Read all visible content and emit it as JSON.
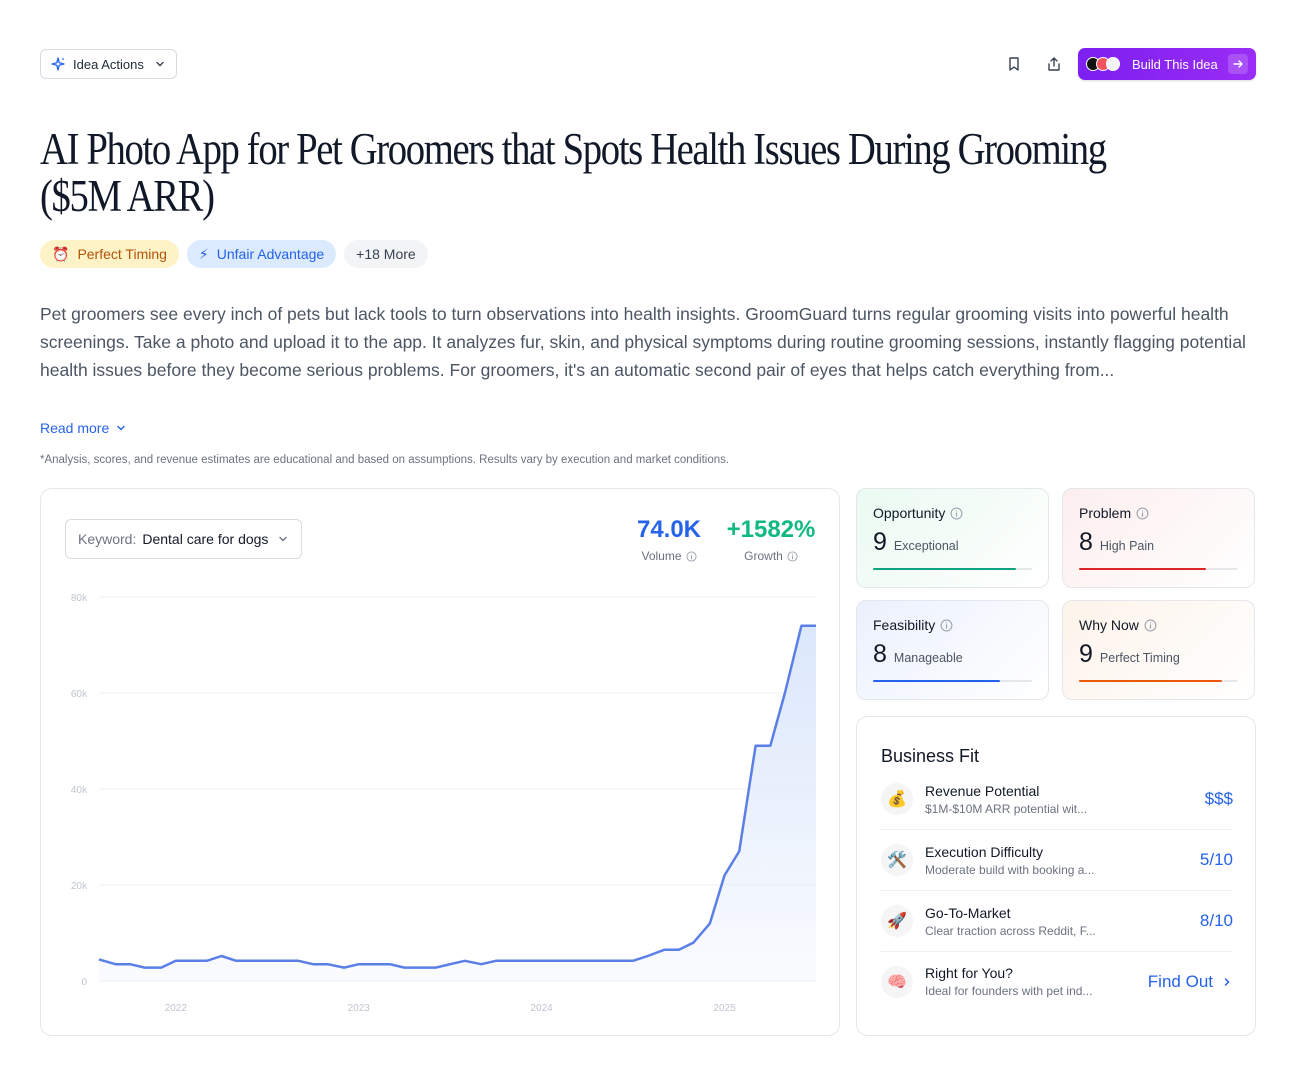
{
  "toolbar": {
    "idea_actions_label": "Idea Actions",
    "build_label": "Build This Idea"
  },
  "title": "AI Photo App for Pet Groomers that Spots Health Issues During Grooming ($5M ARR)",
  "tags": [
    {
      "icon": "alarm-clock-icon",
      "label": "Perfect Timing"
    },
    {
      "icon": "lightning-icon",
      "label": "Unfair Advantage"
    },
    {
      "label": "+18 More"
    }
  ],
  "description": "Pet groomers see every inch of pets but lack tools to turn observations into health insights. GroomGuard turns regular grooming visits into powerful health screenings. Take a photo and upload it to the app. It analyzes fur, skin, and physical symptoms during routine grooming sessions, instantly flagging potential health issues before they become serious problems. For groomers, it's an automatic second pair of eyes that helps catch everything from...",
  "read_more": "Read more",
  "disclaimer": "*Analysis, scores, and revenue estimates are educational and based on assumptions. Results vary by execution and market conditions.",
  "keyword": {
    "label": "Keyword:",
    "value": "Dental care for dogs"
  },
  "metrics": {
    "volume": {
      "value": "74.0K",
      "label": "Volume",
      "color": "#2563eb"
    },
    "growth": {
      "value": "+1582%",
      "label": "Growth",
      "color": "#10b981"
    }
  },
  "chart_data": {
    "type": "area",
    "ylim": [
      0,
      80000
    ],
    "yticks": [
      0,
      20000,
      40000,
      60000,
      80000
    ],
    "ytick_labels": [
      "0",
      "20k",
      "40k",
      "60k",
      "80k"
    ],
    "xtick_labels": [
      "2022",
      "2023",
      "2024",
      "2025"
    ],
    "xtick_positions": [
      2022.0,
      2023.0,
      2024.0,
      2025.0
    ],
    "x": [
      2021.58,
      2021.67,
      2021.75,
      2021.83,
      2021.92,
      2022.0,
      2022.08,
      2022.17,
      2022.25,
      2022.33,
      2022.42,
      2022.5,
      2022.58,
      2022.67,
      2022.75,
      2022.83,
      2022.92,
      2023.0,
      2023.08,
      2023.17,
      2023.25,
      2023.33,
      2023.42,
      2023.5,
      2023.58,
      2023.67,
      2023.75,
      2023.83,
      2023.92,
      2024.0,
      2024.08,
      2024.17,
      2024.25,
      2024.33,
      2024.42,
      2024.5,
      2024.58,
      2024.67,
      2024.75,
      2024.83,
      2024.92,
      2025.0,
      2025.08,
      2025.17,
      2025.25,
      2025.33,
      2025.42,
      2025.5
    ],
    "values": [
      4500,
      3500,
      3500,
      2800,
      2800,
      4200,
      4200,
      4200,
      5200,
      4200,
      4200,
      4200,
      4200,
      4200,
      3500,
      3500,
      2800,
      3500,
      3500,
      3500,
      2800,
      2800,
      2800,
      3500,
      4200,
      3500,
      4200,
      4200,
      4200,
      4200,
      4200,
      4200,
      4200,
      4200,
      4200,
      4200,
      5200,
      6500,
      6500,
      8000,
      12000,
      22000,
      27000,
      49000,
      49000,
      60000,
      74000,
      74000
    ],
    "line_color": "#5b7fe6",
    "fill_color": "#dbe7fb"
  },
  "scores": [
    {
      "title": "Opportunity",
      "score": "9",
      "quality": "Exceptional",
      "fraction": 0.9,
      "color": "#10a37f",
      "bg": "#eafaf1"
    },
    {
      "title": "Problem",
      "score": "8",
      "quality": "High Pain",
      "fraction": 0.8,
      "color": "#dc2626",
      "bg": "#fdeeee"
    },
    {
      "title": "Feasibility",
      "score": "8",
      "quality": "Manageable",
      "fraction": 0.8,
      "color": "#2563eb",
      "bg": "#ebf1fd"
    },
    {
      "title": "Why Now",
      "score": "9",
      "quality": "Perfect Timing",
      "fraction": 0.9,
      "color": "#ea580c",
      "bg": "#fdf3ea"
    }
  ],
  "business_fit": {
    "title": "Business Fit",
    "rows": [
      {
        "icon": "money-bag-icon",
        "emoji": "💰",
        "title": "Revenue Potential",
        "subtitle": "$1M-$10M ARR potential wit...",
        "value": "$$$"
      },
      {
        "icon": "tools-icon",
        "emoji": "🛠️",
        "title": "Execution Difficulty",
        "subtitle": "Moderate build with booking a...",
        "value": "5/10"
      },
      {
        "icon": "rocket-icon",
        "emoji": "🚀",
        "title": "Go-To-Market",
        "subtitle": "Clear traction across Reddit, F...",
        "value": "8/10"
      },
      {
        "icon": "brain-icon",
        "emoji": "🧠",
        "title": "Right for You?",
        "subtitle": "Ideal for founders with pet ind...",
        "value": "Find Out"
      }
    ]
  }
}
